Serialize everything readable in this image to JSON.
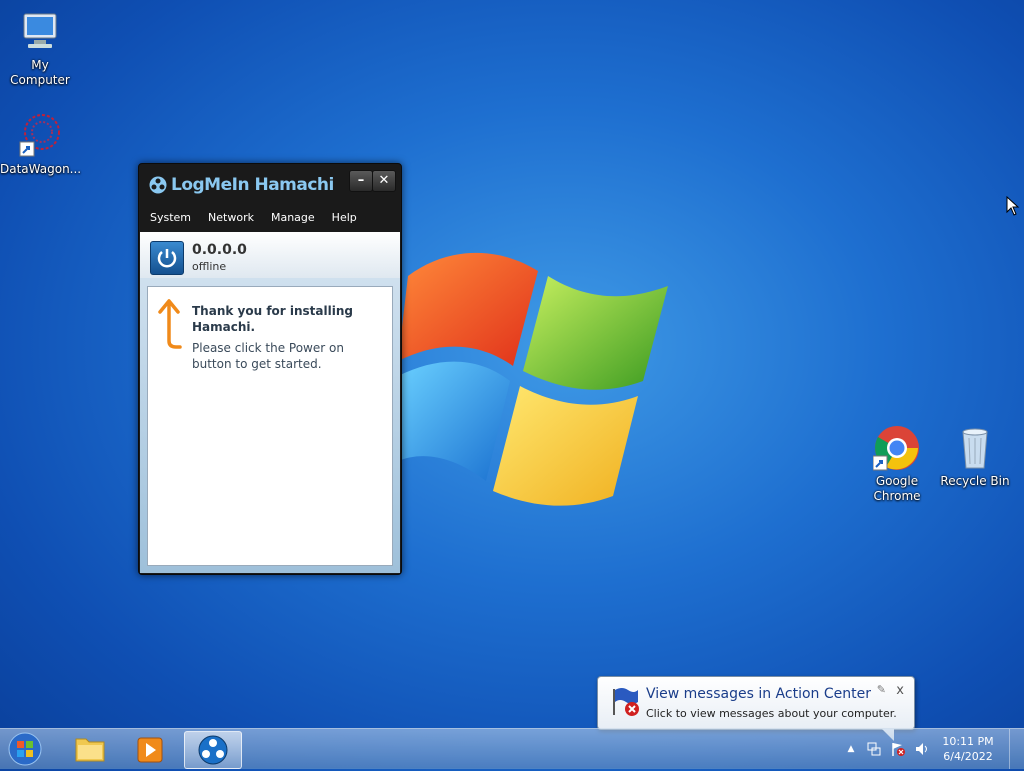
{
  "desktop": {
    "icons": [
      {
        "label": "My Computer",
        "icon": "computer-icon"
      },
      {
        "label": "DataWagon...",
        "icon": "datawagon-icon"
      },
      {
        "label": "Google Chrome",
        "icon": "chrome-icon"
      },
      {
        "label": "Recycle Bin",
        "icon": "recycle-bin-icon"
      }
    ]
  },
  "hamachi": {
    "title": "LogMeIn Hamachi",
    "menu": [
      "System",
      "Network",
      "Manage",
      "Help"
    ],
    "ip": "0.0.0.0",
    "status": "offline",
    "welcome_title": "Thank you for installing Hamachi.",
    "welcome_text": "Please click the Power on button to get started.",
    "minimize_label": "–",
    "close_label": "✕"
  },
  "notification": {
    "title": "View messages in Action Center",
    "text": "Click to view messages about your computer.",
    "close_label": "x"
  },
  "taskbar": {
    "time": "10:11 PM",
    "date": "6/4/2022",
    "tray_arrow": "▲"
  },
  "colors": {
    "desktop": "#1e6fd0",
    "hamachi_title": "#8ac8f0",
    "notification_title": "#1a3d8a"
  }
}
